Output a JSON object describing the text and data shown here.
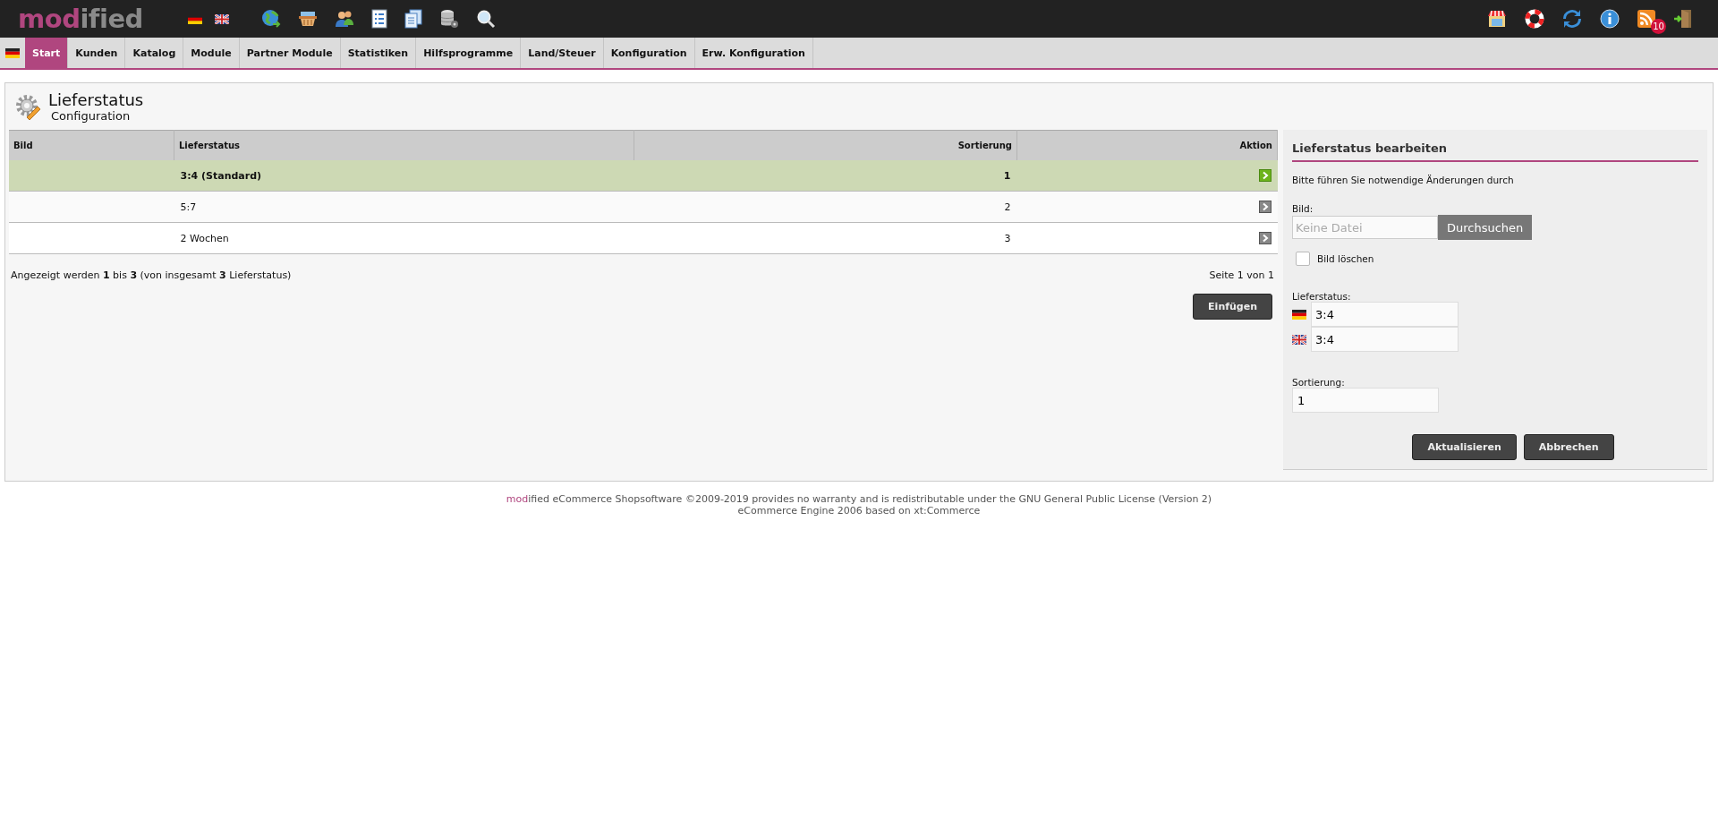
{
  "header": {
    "logo": [
      {
        "text": "mod",
        "color": "#b0467f"
      },
      {
        "text": "ified",
        "color": "#8a8a8a"
      }
    ],
    "feed_badge": "10"
  },
  "menu": {
    "items": [
      {
        "label": "Start",
        "selected": true
      },
      {
        "label": "Kunden",
        "selected": false
      },
      {
        "label": "Katalog",
        "selected": false
      },
      {
        "label": "Module",
        "selected": false
      },
      {
        "label": "Partner Module",
        "selected": false
      },
      {
        "label": "Statistiken",
        "selected": false
      },
      {
        "label": "Hilfsprogramme",
        "selected": false
      },
      {
        "label": "Land/Steuer",
        "selected": false
      },
      {
        "label": "Konfiguration",
        "selected": false
      },
      {
        "label": "Erw. Konfiguration",
        "selected": false
      }
    ]
  },
  "page": {
    "title": "Lieferstatus",
    "subtitle": "Configuration"
  },
  "table": {
    "columns": [
      "Bild",
      "Lieferstatus",
      "Sortierung",
      "Aktion"
    ],
    "rows": [
      {
        "name": "3:4 (Standard)",
        "sort": "1",
        "selected": true
      },
      {
        "name": "5:7",
        "sort": "2",
        "selected": false
      },
      {
        "name": "2 Wochen",
        "sort": "3",
        "selected": false
      }
    ]
  },
  "pagination": {
    "summary": "Angezeigt werden **1** bis **3** (von insgesamt **3** Lieferstatus)",
    "pages": "Seite 1 von 1"
  },
  "insert_button": "Einfügen",
  "edit_panel": {
    "title": "Lieferstatus bearbeiten",
    "hint": "Bitte führen Sie notwendige Änderungen durch",
    "image_label": "Bild:",
    "file_placeholder": "Keine Datei",
    "browse_button": "Durchsuchen",
    "delete_image": {
      "label": "Bild löschen",
      "checked": false
    },
    "status_label": "Lieferstatus:",
    "status_values": [
      {
        "kind": "german",
        "value": "3:4"
      },
      {
        "kind": "british",
        "value": "3:4"
      }
    ],
    "sort_label": "Sortierung:",
    "sort_value": "1",
    "buttons": [
      "Aktualisieren",
      "Abbrechen"
    ]
  },
  "footer": {
    "brand": [
      {
        "text": "mod",
        "color": "#b0467f"
      },
      {
        "text": "ified",
        "color": "#555555"
      }
    ],
    "line1": " eCommerce Shopsoftware ©2009-2019 provides no warranty and is redistributable under the GNU General Public License (Version 2)",
    "line2": "eCommerce Engine 2006 based on xt:Commerce"
  }
}
